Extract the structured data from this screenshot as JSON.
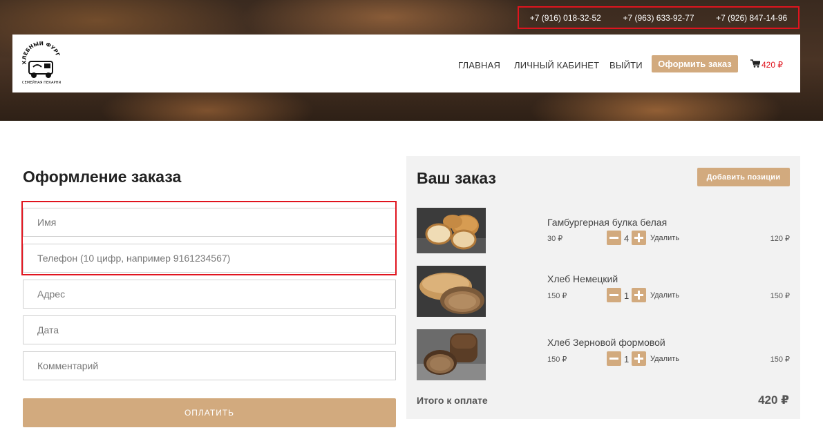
{
  "header": {
    "phones": [
      "+7 (916) 018-32-52",
      "+7 (963) 633-92-77",
      "+7 (926) 847-14-96"
    ],
    "logo": {
      "top_text": "ХЛЕБНЫЙ ФУРГОН",
      "bottom_text": "СЕМЕЙНАЯ ПЕКАРНЯ"
    },
    "nav": {
      "home": "ГЛАВНАЯ",
      "account": "ЛИЧНЫЙ КАБИНЕТ",
      "logout": "ВЫЙТИ"
    },
    "order_button": "Оформить заказ",
    "cart_total": "420 ₽",
    "cart_icon": "shopping-cart-icon"
  },
  "checkout": {
    "title": "Оформление заказа",
    "fields": {
      "name_placeholder": "Имя",
      "phone_placeholder": "Телефон (10 цифр, например 9161234567)",
      "address_placeholder": "Адрес",
      "date_placeholder": "Дата",
      "comment_placeholder": "Комментарий"
    },
    "pay_button": "ОПЛАТИТЬ"
  },
  "order": {
    "title": "Ваш заказ",
    "add_button": "Добавить позиции",
    "items": [
      {
        "name": "Гамбургерная булка белая",
        "price": "30 ₽",
        "qty": "4",
        "remove": "Удалить",
        "sum": "120 ₽"
      },
      {
        "name": "Хлеб Немецкий",
        "price": "150 ₽",
        "qty": "1",
        "remove": "Удалить",
        "sum": "150 ₽"
      },
      {
        "name": "Хлеб Зерновой формовой",
        "price": "150 ₽",
        "qty": "1",
        "remove": "Удалить",
        "sum": "150 ₽"
      }
    ],
    "total_label": "Итого к оплате",
    "total_value": "420 ₽"
  },
  "colors": {
    "accent": "#d2aa7e",
    "highlight": "#e0141e",
    "panel": "#f2f2f2"
  }
}
